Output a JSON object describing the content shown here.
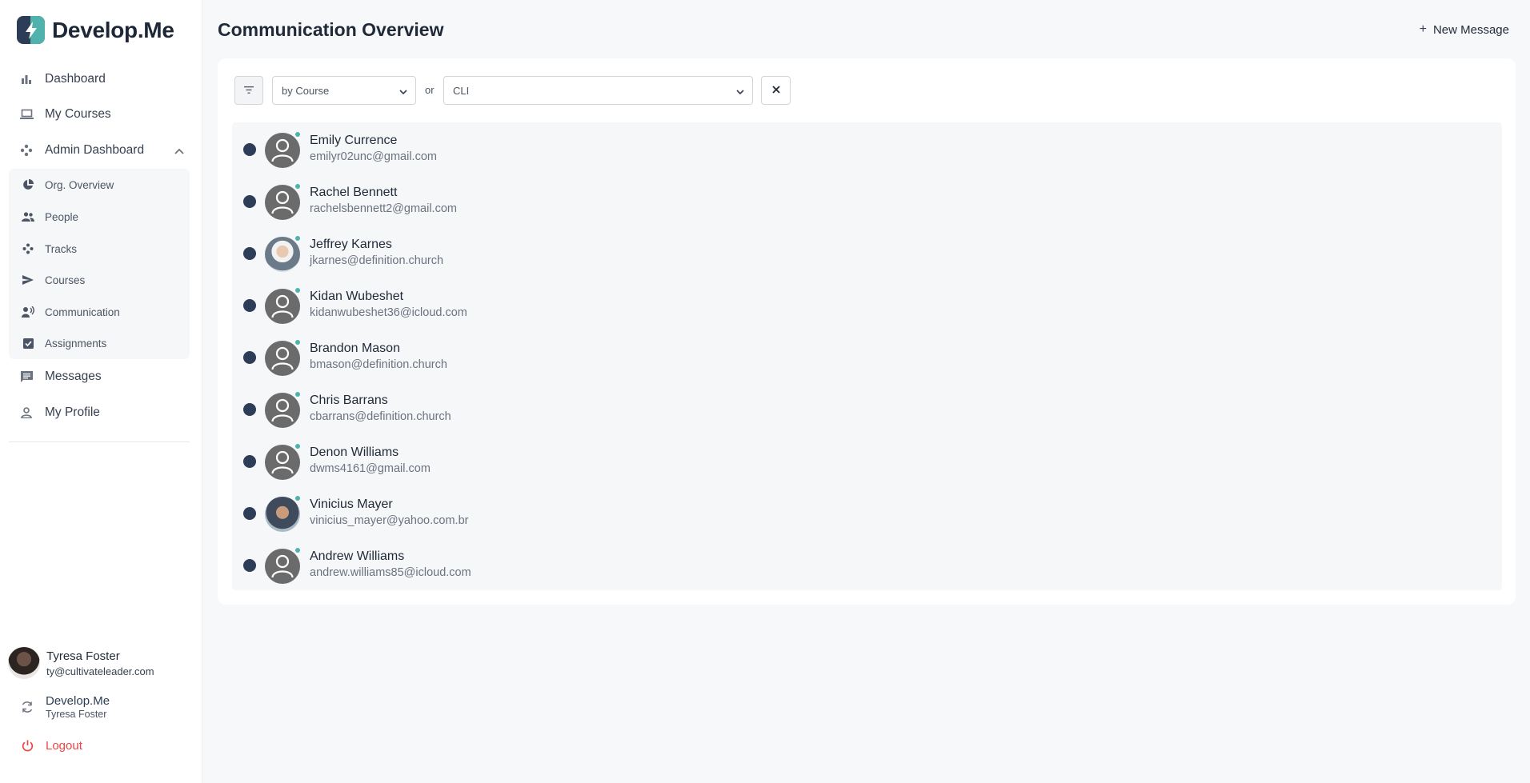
{
  "brand": {
    "name": "Develop.Me",
    "colors": {
      "navy": "#2e3d57",
      "teal": "#4fb2ad",
      "logout": "#ef4444"
    }
  },
  "sidebar": {
    "items": [
      {
        "label": "Dashboard",
        "icon": "bar-chart-icon"
      },
      {
        "label": "My Courses",
        "icon": "laptop-icon"
      },
      {
        "label": "Admin Dashboard",
        "icon": "hub-icon"
      }
    ],
    "admin_sub": [
      {
        "label": "Org. Overview",
        "icon": "pie-chart-icon"
      },
      {
        "label": "People",
        "icon": "people-icon"
      },
      {
        "label": "Tracks",
        "icon": "tracks-icon"
      },
      {
        "label": "Courses",
        "icon": "send-icon"
      },
      {
        "label": "Communication",
        "icon": "communication-icon"
      },
      {
        "label": "Assignments",
        "icon": "checkbox-icon"
      }
    ],
    "bottom_items": [
      {
        "label": "Messages",
        "icon": "chat-icon"
      },
      {
        "label": "My Profile",
        "icon": "person-icon"
      }
    ],
    "user": {
      "name": "Tyresa Foster",
      "email": "ty@cultivateleader.com"
    },
    "org": {
      "name": "Develop.Me",
      "user": "Tyresa Foster"
    },
    "logout_label": "Logout"
  },
  "main": {
    "title": "Communication Overview",
    "new_message_label": "New Message",
    "filters": {
      "group_by": "by Course",
      "or_label": "or",
      "course": "CLI"
    },
    "people": [
      {
        "name": "Emily Currence",
        "email": "emilyr02unc@gmail.com",
        "avatar": "default"
      },
      {
        "name": "Rachel Bennett",
        "email": "rachelsbennett2@gmail.com",
        "avatar": "default"
      },
      {
        "name": "Jeffrey Karnes",
        "email": "jkarnes@definition.church",
        "avatar": "photo1"
      },
      {
        "name": "Kidan Wubeshet",
        "email": "kidanwubeshet36@icloud.com",
        "avatar": "default"
      },
      {
        "name": "Brandon Mason",
        "email": "bmason@definition.church",
        "avatar": "default"
      },
      {
        "name": "Chris Barrans",
        "email": "cbarrans@definition.church",
        "avatar": "default"
      },
      {
        "name": "Denon Williams",
        "email": "dwms4161@gmail.com",
        "avatar": "default"
      },
      {
        "name": "Vinicius Mayer",
        "email": "vinicius_mayer@yahoo.com.br",
        "avatar": "photo2"
      },
      {
        "name": "Andrew  Williams",
        "email": "andrew.williams85@icloud.com",
        "avatar": "default"
      }
    ]
  }
}
